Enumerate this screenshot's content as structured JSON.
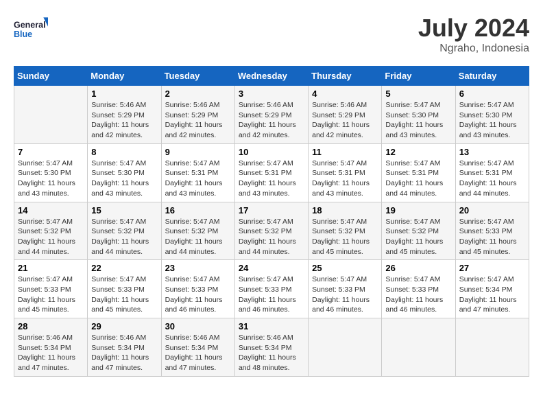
{
  "header": {
    "logo_general": "General",
    "logo_blue": "Blue",
    "month_year": "July 2024",
    "location": "Ngraho, Indonesia"
  },
  "weekdays": [
    "Sunday",
    "Monday",
    "Tuesday",
    "Wednesday",
    "Thursday",
    "Friday",
    "Saturday"
  ],
  "weeks": [
    [
      {
        "day": "",
        "sunrise": "",
        "sunset": "",
        "daylight": ""
      },
      {
        "day": "1",
        "sunrise": "Sunrise: 5:46 AM",
        "sunset": "Sunset: 5:29 PM",
        "daylight": "Daylight: 11 hours and 42 minutes."
      },
      {
        "day": "2",
        "sunrise": "Sunrise: 5:46 AM",
        "sunset": "Sunset: 5:29 PM",
        "daylight": "Daylight: 11 hours and 42 minutes."
      },
      {
        "day": "3",
        "sunrise": "Sunrise: 5:46 AM",
        "sunset": "Sunset: 5:29 PM",
        "daylight": "Daylight: 11 hours and 42 minutes."
      },
      {
        "day": "4",
        "sunrise": "Sunrise: 5:46 AM",
        "sunset": "Sunset: 5:29 PM",
        "daylight": "Daylight: 11 hours and 42 minutes."
      },
      {
        "day": "5",
        "sunrise": "Sunrise: 5:47 AM",
        "sunset": "Sunset: 5:30 PM",
        "daylight": "Daylight: 11 hours and 43 minutes."
      },
      {
        "day": "6",
        "sunrise": "Sunrise: 5:47 AM",
        "sunset": "Sunset: 5:30 PM",
        "daylight": "Daylight: 11 hours and 43 minutes."
      }
    ],
    [
      {
        "day": "7",
        "sunrise": "Sunrise: 5:47 AM",
        "sunset": "Sunset: 5:30 PM",
        "daylight": "Daylight: 11 hours and 43 minutes."
      },
      {
        "day": "8",
        "sunrise": "Sunrise: 5:47 AM",
        "sunset": "Sunset: 5:30 PM",
        "daylight": "Daylight: 11 hours and 43 minutes."
      },
      {
        "day": "9",
        "sunrise": "Sunrise: 5:47 AM",
        "sunset": "Sunset: 5:31 PM",
        "daylight": "Daylight: 11 hours and 43 minutes."
      },
      {
        "day": "10",
        "sunrise": "Sunrise: 5:47 AM",
        "sunset": "Sunset: 5:31 PM",
        "daylight": "Daylight: 11 hours and 43 minutes."
      },
      {
        "day": "11",
        "sunrise": "Sunrise: 5:47 AM",
        "sunset": "Sunset: 5:31 PM",
        "daylight": "Daylight: 11 hours and 43 minutes."
      },
      {
        "day": "12",
        "sunrise": "Sunrise: 5:47 AM",
        "sunset": "Sunset: 5:31 PM",
        "daylight": "Daylight: 11 hours and 44 minutes."
      },
      {
        "day": "13",
        "sunrise": "Sunrise: 5:47 AM",
        "sunset": "Sunset: 5:31 PM",
        "daylight": "Daylight: 11 hours and 44 minutes."
      }
    ],
    [
      {
        "day": "14",
        "sunrise": "Sunrise: 5:47 AM",
        "sunset": "Sunset: 5:32 PM",
        "daylight": "Daylight: 11 hours and 44 minutes."
      },
      {
        "day": "15",
        "sunrise": "Sunrise: 5:47 AM",
        "sunset": "Sunset: 5:32 PM",
        "daylight": "Daylight: 11 hours and 44 minutes."
      },
      {
        "day": "16",
        "sunrise": "Sunrise: 5:47 AM",
        "sunset": "Sunset: 5:32 PM",
        "daylight": "Daylight: 11 hours and 44 minutes."
      },
      {
        "day": "17",
        "sunrise": "Sunrise: 5:47 AM",
        "sunset": "Sunset: 5:32 PM",
        "daylight": "Daylight: 11 hours and 44 minutes."
      },
      {
        "day": "18",
        "sunrise": "Sunrise: 5:47 AM",
        "sunset": "Sunset: 5:32 PM",
        "daylight": "Daylight: 11 hours and 45 minutes."
      },
      {
        "day": "19",
        "sunrise": "Sunrise: 5:47 AM",
        "sunset": "Sunset: 5:32 PM",
        "daylight": "Daylight: 11 hours and 45 minutes."
      },
      {
        "day": "20",
        "sunrise": "Sunrise: 5:47 AM",
        "sunset": "Sunset: 5:33 PM",
        "daylight": "Daylight: 11 hours and 45 minutes."
      }
    ],
    [
      {
        "day": "21",
        "sunrise": "Sunrise: 5:47 AM",
        "sunset": "Sunset: 5:33 PM",
        "daylight": "Daylight: 11 hours and 45 minutes."
      },
      {
        "day": "22",
        "sunrise": "Sunrise: 5:47 AM",
        "sunset": "Sunset: 5:33 PM",
        "daylight": "Daylight: 11 hours and 45 minutes."
      },
      {
        "day": "23",
        "sunrise": "Sunrise: 5:47 AM",
        "sunset": "Sunset: 5:33 PM",
        "daylight": "Daylight: 11 hours and 46 minutes."
      },
      {
        "day": "24",
        "sunrise": "Sunrise: 5:47 AM",
        "sunset": "Sunset: 5:33 PM",
        "daylight": "Daylight: 11 hours and 46 minutes."
      },
      {
        "day": "25",
        "sunrise": "Sunrise: 5:47 AM",
        "sunset": "Sunset: 5:33 PM",
        "daylight": "Daylight: 11 hours and 46 minutes."
      },
      {
        "day": "26",
        "sunrise": "Sunrise: 5:47 AM",
        "sunset": "Sunset: 5:33 PM",
        "daylight": "Daylight: 11 hours and 46 minutes."
      },
      {
        "day": "27",
        "sunrise": "Sunrise: 5:47 AM",
        "sunset": "Sunset: 5:34 PM",
        "daylight": "Daylight: 11 hours and 47 minutes."
      }
    ],
    [
      {
        "day": "28",
        "sunrise": "Sunrise: 5:46 AM",
        "sunset": "Sunset: 5:34 PM",
        "daylight": "Daylight: 11 hours and 47 minutes."
      },
      {
        "day": "29",
        "sunrise": "Sunrise: 5:46 AM",
        "sunset": "Sunset: 5:34 PM",
        "daylight": "Daylight: 11 hours and 47 minutes."
      },
      {
        "day": "30",
        "sunrise": "Sunrise: 5:46 AM",
        "sunset": "Sunset: 5:34 PM",
        "daylight": "Daylight: 11 hours and 47 minutes."
      },
      {
        "day": "31",
        "sunrise": "Sunrise: 5:46 AM",
        "sunset": "Sunset: 5:34 PM",
        "daylight": "Daylight: 11 hours and 48 minutes."
      },
      {
        "day": "",
        "sunrise": "",
        "sunset": "",
        "daylight": ""
      },
      {
        "day": "",
        "sunrise": "",
        "sunset": "",
        "daylight": ""
      },
      {
        "day": "",
        "sunrise": "",
        "sunset": "",
        "daylight": ""
      }
    ]
  ]
}
